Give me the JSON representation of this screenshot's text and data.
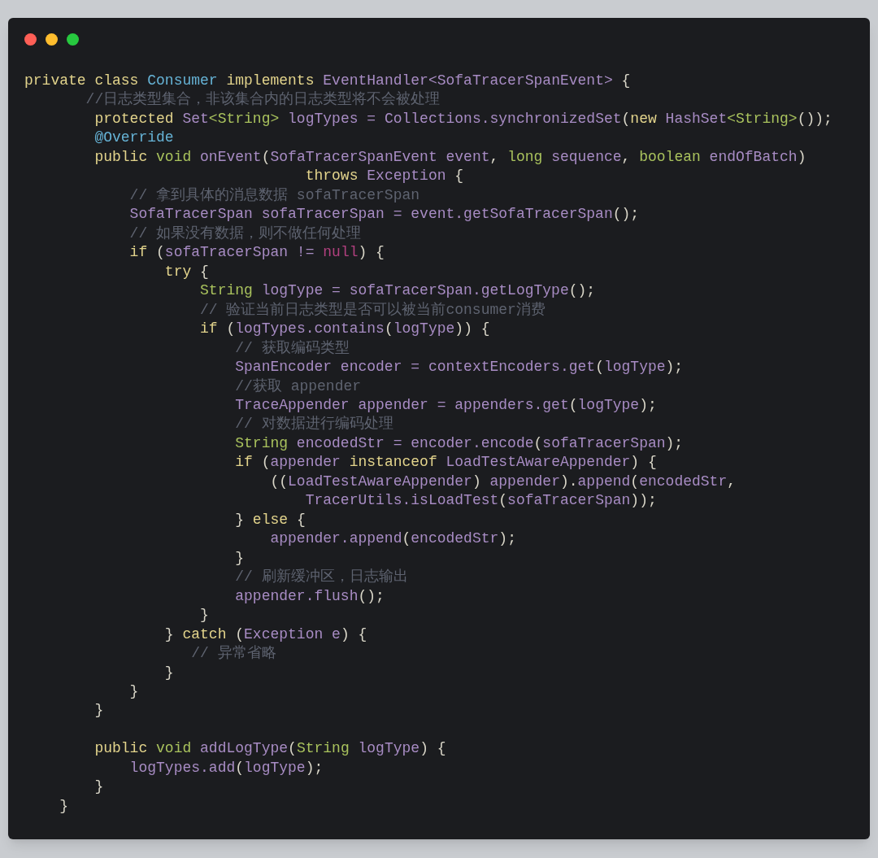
{
  "window": {
    "controls": [
      {
        "color": "#ff5f56"
      },
      {
        "color": "#ffbd2e"
      },
      {
        "color": "#27c93f"
      }
    ]
  },
  "lines": [
    {
      "kind": "code",
      "tokens": [
        {
          "kind": "kw",
          "text": "private class "
        },
        {
          "kind": "cls",
          "text": "Consumer "
        },
        {
          "kind": "kw",
          "text": "implements "
        },
        {
          "kind": "id",
          "text": "EventHandler<SofaTracerSpanEvent>"
        },
        {
          "kind": "p",
          "text": " {"
        }
      ]
    },
    {
      "kind": "code",
      "tokens": [
        {
          "kind": "cm",
          "text": "       //日志类型集合，非该集合内的日志类型将不会被处理"
        }
      ]
    },
    {
      "kind": "code",
      "tokens": [
        {
          "kind": "kw",
          "text": "        protected "
        },
        {
          "kind": "id",
          "text": "Set"
        },
        {
          "kind": "ty",
          "text": "<String>"
        },
        {
          "kind": "id",
          "text": " logTypes = Collections.synchronizedSet"
        },
        {
          "kind": "p",
          "text": "("
        },
        {
          "kind": "kw",
          "text": "new "
        },
        {
          "kind": "id",
          "text": "HashSet"
        },
        {
          "kind": "ty",
          "text": "<String>"
        },
        {
          "kind": "p",
          "text": "());"
        }
      ]
    },
    {
      "kind": "code",
      "tokens": [
        {
          "kind": "cls",
          "text": "        @Override"
        }
      ]
    },
    {
      "kind": "code",
      "tokens": [
        {
          "kind": "kw",
          "text": "        public "
        },
        {
          "kind": "ty",
          "text": "void "
        },
        {
          "kind": "id",
          "text": "onEvent"
        },
        {
          "kind": "p",
          "text": "("
        },
        {
          "kind": "id",
          "text": "SofaTracerSpanEvent event"
        },
        {
          "kind": "p",
          "text": ", "
        },
        {
          "kind": "ty",
          "text": "long "
        },
        {
          "kind": "id",
          "text": "sequence"
        },
        {
          "kind": "p",
          "text": ", "
        },
        {
          "kind": "ty",
          "text": "boolean "
        },
        {
          "kind": "id",
          "text": "endOfBatch"
        },
        {
          "kind": "p",
          "text": ")"
        }
      ]
    },
    {
      "kind": "code",
      "tokens": [
        {
          "kind": "kw",
          "text": "                                throws "
        },
        {
          "kind": "id",
          "text": "Exception"
        },
        {
          "kind": "p",
          "text": " {"
        }
      ]
    },
    {
      "kind": "code",
      "tokens": [
        {
          "kind": "cm",
          "text": "            // 拿到具体的消息数据 sofaTracerSpan"
        }
      ]
    },
    {
      "kind": "code",
      "tokens": [
        {
          "kind": "id",
          "text": "            SofaTracerSpan sofaTracerSpan = event.getSofaTracerSpan"
        },
        {
          "kind": "p",
          "text": "();"
        }
      ]
    },
    {
      "kind": "code",
      "tokens": [
        {
          "kind": "cm",
          "text": "            // 如果没有数据，则不做任何处理"
        }
      ]
    },
    {
      "kind": "code",
      "tokens": [
        {
          "kind": "kw",
          "text": "            if "
        },
        {
          "kind": "p",
          "text": "("
        },
        {
          "kind": "id",
          "text": "sofaTracerSpan != "
        },
        {
          "kind": "nul",
          "text": "null"
        },
        {
          "kind": "p",
          "text": ") {"
        }
      ]
    },
    {
      "kind": "code",
      "tokens": [
        {
          "kind": "kw",
          "text": "                try "
        },
        {
          "kind": "p",
          "text": "{"
        }
      ]
    },
    {
      "kind": "code",
      "tokens": [
        {
          "kind": "ty",
          "text": "                    String "
        },
        {
          "kind": "id",
          "text": "logType = sofaTracerSpan.getLogType"
        },
        {
          "kind": "p",
          "text": "();"
        }
      ]
    },
    {
      "kind": "code",
      "tokens": [
        {
          "kind": "cm",
          "text": "                    // 验证当前日志类型是否可以被当前consumer消费"
        }
      ]
    },
    {
      "kind": "code",
      "tokens": [
        {
          "kind": "kw",
          "text": "                    if "
        },
        {
          "kind": "p",
          "text": "("
        },
        {
          "kind": "id",
          "text": "logTypes.contains"
        },
        {
          "kind": "p",
          "text": "("
        },
        {
          "kind": "id",
          "text": "logType"
        },
        {
          "kind": "p",
          "text": ")) {"
        }
      ]
    },
    {
      "kind": "code",
      "tokens": [
        {
          "kind": "cm",
          "text": "                        // 获取编码类型"
        }
      ]
    },
    {
      "kind": "code",
      "tokens": [
        {
          "kind": "id",
          "text": "                        SpanEncoder encoder = contextEncoders.get"
        },
        {
          "kind": "p",
          "text": "("
        },
        {
          "kind": "id",
          "text": "logType"
        },
        {
          "kind": "p",
          "text": ");"
        }
      ]
    },
    {
      "kind": "code",
      "tokens": [
        {
          "kind": "cm",
          "text": "                        //获取 appender"
        }
      ]
    },
    {
      "kind": "code",
      "tokens": [
        {
          "kind": "id",
          "text": "                        TraceAppender appender = appenders.get"
        },
        {
          "kind": "p",
          "text": "("
        },
        {
          "kind": "id",
          "text": "logType"
        },
        {
          "kind": "p",
          "text": ");"
        }
      ]
    },
    {
      "kind": "code",
      "tokens": [
        {
          "kind": "cm",
          "text": "                        // 对数据进行编码处理"
        }
      ]
    },
    {
      "kind": "code",
      "tokens": [
        {
          "kind": "ty",
          "text": "                        String "
        },
        {
          "kind": "id",
          "text": "encodedStr = encoder.encode"
        },
        {
          "kind": "p",
          "text": "("
        },
        {
          "kind": "id",
          "text": "sofaTracerSpan"
        },
        {
          "kind": "p",
          "text": ");"
        }
      ]
    },
    {
      "kind": "code",
      "tokens": [
        {
          "kind": "kw",
          "text": "                        if "
        },
        {
          "kind": "p",
          "text": "("
        },
        {
          "kind": "id",
          "text": "appender "
        },
        {
          "kind": "kw",
          "text": "instanceof "
        },
        {
          "kind": "id",
          "text": "LoadTestAwareAppender"
        },
        {
          "kind": "p",
          "text": ") {"
        }
      ]
    },
    {
      "kind": "code",
      "tokens": [
        {
          "kind": "p",
          "text": "                            (("
        },
        {
          "kind": "id",
          "text": "LoadTestAwareAppender"
        },
        {
          "kind": "p",
          "text": ") "
        },
        {
          "kind": "id",
          "text": "appender"
        },
        {
          "kind": "p",
          "text": ")."
        },
        {
          "kind": "id",
          "text": "append"
        },
        {
          "kind": "p",
          "text": "("
        },
        {
          "kind": "id",
          "text": "encodedStr"
        },
        {
          "kind": "p",
          "text": ","
        }
      ]
    },
    {
      "kind": "code",
      "tokens": [
        {
          "kind": "id",
          "text": "                                TracerUtils.isLoadTest"
        },
        {
          "kind": "p",
          "text": "("
        },
        {
          "kind": "id",
          "text": "sofaTracerSpan"
        },
        {
          "kind": "p",
          "text": "));"
        }
      ]
    },
    {
      "kind": "code",
      "tokens": [
        {
          "kind": "p",
          "text": "                        } "
        },
        {
          "kind": "kw",
          "text": "else "
        },
        {
          "kind": "p",
          "text": "{"
        }
      ]
    },
    {
      "kind": "code",
      "tokens": [
        {
          "kind": "id",
          "text": "                            appender.append"
        },
        {
          "kind": "p",
          "text": "("
        },
        {
          "kind": "id",
          "text": "encodedStr"
        },
        {
          "kind": "p",
          "text": ");"
        }
      ]
    },
    {
      "kind": "code",
      "tokens": [
        {
          "kind": "p",
          "text": "                        }"
        }
      ]
    },
    {
      "kind": "code",
      "tokens": [
        {
          "kind": "cm",
          "text": "                        // 刷新缓冲区，日志输出"
        }
      ]
    },
    {
      "kind": "code",
      "tokens": [
        {
          "kind": "id",
          "text": "                        appender.flush"
        },
        {
          "kind": "p",
          "text": "();"
        }
      ]
    },
    {
      "kind": "code",
      "tokens": [
        {
          "kind": "p",
          "text": "                    }"
        }
      ]
    },
    {
      "kind": "code",
      "tokens": [
        {
          "kind": "p",
          "text": "                } "
        },
        {
          "kind": "kw",
          "text": "catch "
        },
        {
          "kind": "p",
          "text": "("
        },
        {
          "kind": "id",
          "text": "Exception e"
        },
        {
          "kind": "p",
          "text": ") {"
        }
      ]
    },
    {
      "kind": "code",
      "tokens": [
        {
          "kind": "cm",
          "text": "                   // 异常省略"
        }
      ]
    },
    {
      "kind": "code",
      "tokens": [
        {
          "kind": "p",
          "text": "                }"
        }
      ]
    },
    {
      "kind": "code",
      "tokens": [
        {
          "kind": "p",
          "text": "            }"
        }
      ]
    },
    {
      "kind": "code",
      "tokens": [
        {
          "kind": "p",
          "text": "        }"
        }
      ]
    },
    {
      "kind": "blank"
    },
    {
      "kind": "code",
      "tokens": [
        {
          "kind": "kw",
          "text": "        public "
        },
        {
          "kind": "ty",
          "text": "void "
        },
        {
          "kind": "id",
          "text": "addLogType"
        },
        {
          "kind": "p",
          "text": "("
        },
        {
          "kind": "ty",
          "text": "String "
        },
        {
          "kind": "id",
          "text": "logType"
        },
        {
          "kind": "p",
          "text": ") {"
        }
      ]
    },
    {
      "kind": "code",
      "tokens": [
        {
          "kind": "id",
          "text": "            logTypes.add"
        },
        {
          "kind": "p",
          "text": "("
        },
        {
          "kind": "id",
          "text": "logType"
        },
        {
          "kind": "p",
          "text": ");"
        }
      ]
    },
    {
      "kind": "code",
      "tokens": [
        {
          "kind": "p",
          "text": "        }"
        }
      ]
    },
    {
      "kind": "code",
      "tokens": [
        {
          "kind": "p",
          "text": "    }"
        }
      ]
    }
  ]
}
